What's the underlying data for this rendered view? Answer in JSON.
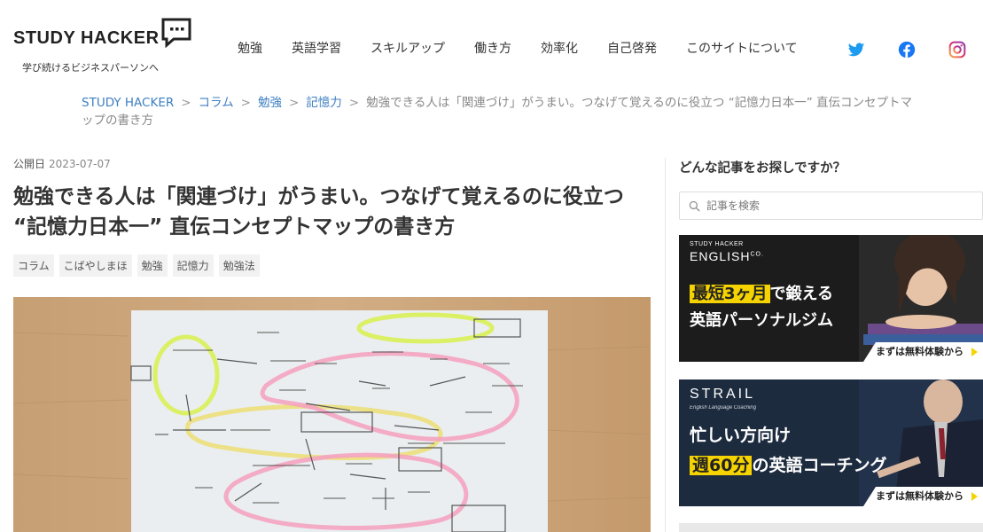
{
  "site": {
    "logo_text": "STUDY HACKER",
    "tagline": "学び続けるビジネスパーソンへ"
  },
  "nav": {
    "items": [
      "勉強",
      "英語学習",
      "スキルアップ",
      "働き方",
      "効率化",
      "自己啓発",
      "このサイトについて"
    ],
    "social": [
      "twitter-icon",
      "facebook-icon",
      "instagram-icon"
    ]
  },
  "breadcrumb": {
    "items": [
      "STUDY HACKER",
      "コラム",
      "勉強",
      "記憶力"
    ],
    "separator": ">",
    "current": "勉強できる人は「関連づけ」がうまい。つなげて覚えるのに役立つ “記憶力日本一” 直伝コンセプトマップの書き方"
  },
  "article": {
    "pub_label": "公開日",
    "pub_date": "2023-07-07",
    "title": "勉強できる人は「関連づけ」がうまい。つなげて覚えるのに役立つ “記憶力日本一” 直伝コンセプトマップの書き方",
    "tags": [
      "コラム",
      "こばやしまほ",
      "勉強",
      "記憶力",
      "勉強法"
    ]
  },
  "sidebar": {
    "title": "どんな記事をお探しですか？",
    "search_placeholder": "記事を検索",
    "banner1": {
      "brand_top": "STUDY HACKER",
      "brand": "ENGLISH",
      "brand_sup": "CO.",
      "line1_hl": "最短3ヶ月",
      "line1_rest": "で鍛える",
      "line2": "英語パーソナルジム",
      "cta": "まずは無料体験から"
    },
    "banner2": {
      "brand": "STRAIL",
      "brand_sub": "English Language Coaching",
      "line1": "忙しい方向け",
      "line2_hl": "週60分",
      "line2_rest": "の英語コーチング",
      "cta": "まずは無料体験から"
    }
  },
  "colors": {
    "link": "#3e7fc1",
    "twitter": "#1d9bf0",
    "facebook": "#1877f2",
    "instagram": "#e1306c",
    "highlight": "#f5d300"
  }
}
